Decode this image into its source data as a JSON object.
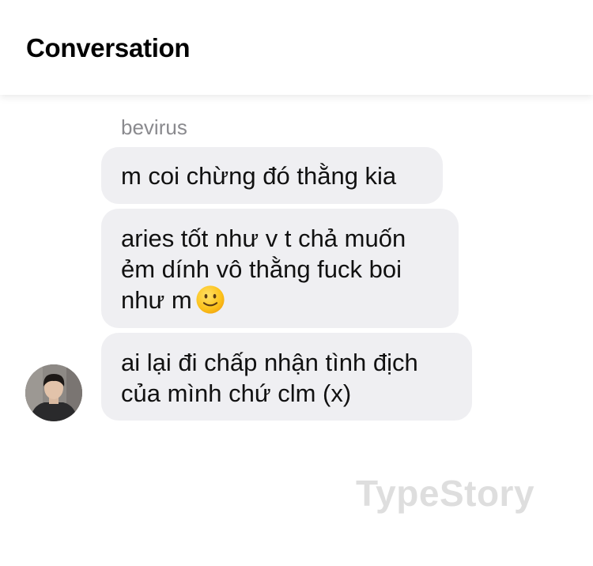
{
  "header": {
    "title": "Conversation"
  },
  "conversation": {
    "sender_name": "bevirus",
    "messages": [
      {
        "text": "m coi chừng đó thằng kia"
      },
      {
        "text": "aries tốt như v t chả muốn ẻm dính vô thằng fuck boi như m",
        "emoji": "slightly-smiling-face"
      },
      {
        "text": "ai lại đi chấp nhận tình địch của mình chứ clm (x)"
      }
    ]
  },
  "watermark": {
    "text": "TypeStory"
  },
  "colors": {
    "bubble": "#efeff2",
    "sender": "#8a8a8e",
    "watermark": "#dedede"
  }
}
